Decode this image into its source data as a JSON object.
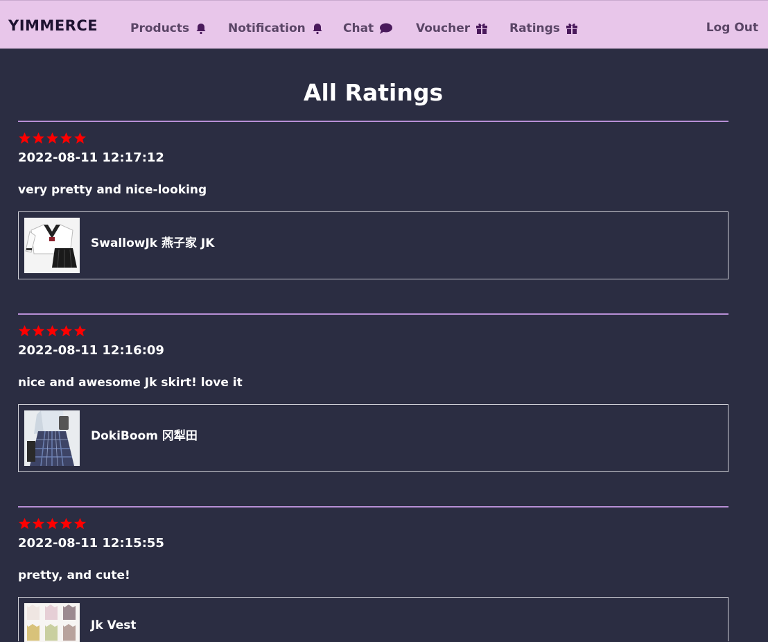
{
  "brand": "YIMMERCE",
  "nav": {
    "items": [
      {
        "label": "Products",
        "icon": "bell-icon"
      },
      {
        "label": "Notification",
        "icon": "bell-icon"
      },
      {
        "label": "Chat",
        "icon": "chat-bubble-icon"
      },
      {
        "label": "Voucher",
        "icon": "gift-icon"
      },
      {
        "label": "Ratings",
        "icon": "gift-icon"
      }
    ],
    "logout": "Log Out"
  },
  "page": {
    "title": "All Ratings"
  },
  "ratings": [
    {
      "stars": 5,
      "timestamp": "2022-08-11 12:17:12",
      "comment": "very pretty and nice-looking",
      "product": {
        "name": "SwallowJk 燕子家 JK",
        "image": "sailor-uniform-thumbnail"
      }
    },
    {
      "stars": 5,
      "timestamp": "2022-08-11 12:16:09",
      "comment": "nice and awesome Jk skirt! love it",
      "product": {
        "name": "DokiBoom 冈犁田",
        "image": "plaid-skirt-thumbnail"
      }
    },
    {
      "stars": 5,
      "timestamp": "2022-08-11 12:15:55",
      "comment": "pretty, and cute!",
      "product": {
        "name": "Jk Vest",
        "image": "vest-colors-thumbnail"
      }
    }
  ],
  "colors": {
    "navbar": "#e8c6ea",
    "background": "#2b2d42",
    "divider": "#b88fd6",
    "star": "#ff0000",
    "icon": "#4a1a5c"
  }
}
